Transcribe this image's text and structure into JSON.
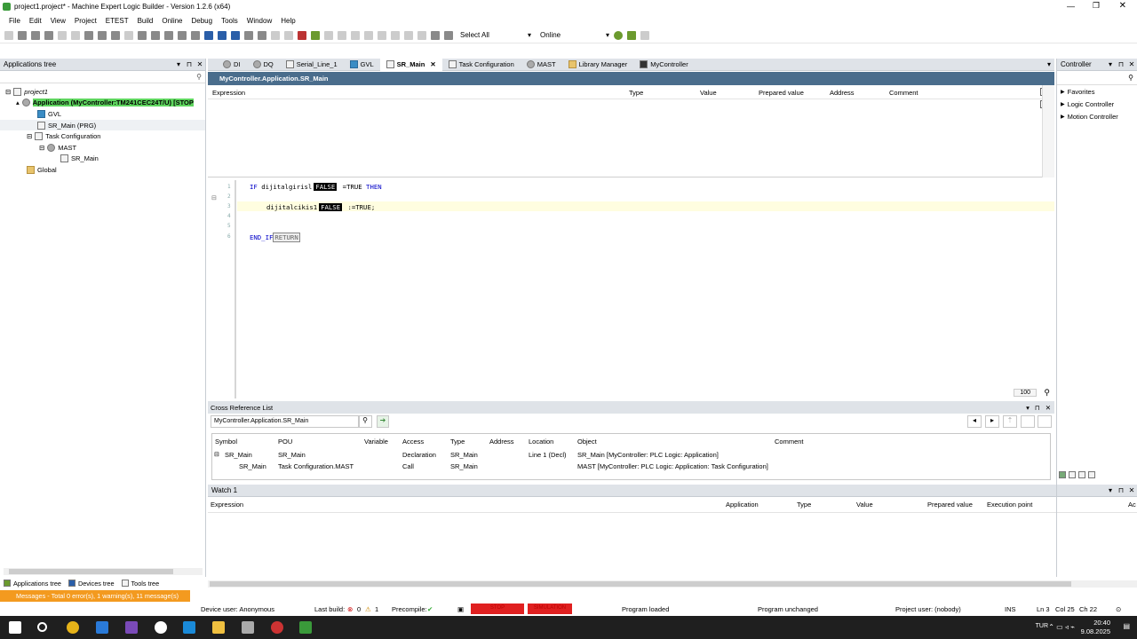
{
  "window": {
    "title": "project1.project* - Machine Expert Logic Builder - Version 1.2.6 (x64)"
  },
  "menu": [
    "File",
    "Edit",
    "View",
    "Project",
    "ETEST",
    "Build",
    "Online",
    "Debug",
    "Tools",
    "Window",
    "Help"
  ],
  "toolbar": {
    "select_all": "Select All",
    "online": "Online"
  },
  "apps_tree": {
    "title": "Applications tree",
    "items": [
      {
        "label": "project1",
        "icon": "project-icon"
      },
      {
        "label": "Application (MyController:TM241CEC24T/U) [STOP",
        "icon": "application-icon"
      },
      {
        "label": "GVL",
        "icon": "gvl-icon"
      },
      {
        "label": "SR_Main (PRG)",
        "icon": "program-icon"
      },
      {
        "label": "Task Configuration",
        "icon": "task-config-icon"
      },
      {
        "label": "MAST",
        "icon": "task-icon"
      },
      {
        "label": "SR_Main",
        "icon": "program-icon"
      },
      {
        "label": "Global",
        "icon": "folder-icon"
      }
    ]
  },
  "tabs": [
    {
      "label": "DI"
    },
    {
      "label": "DQ"
    },
    {
      "label": "Serial_Line_1"
    },
    {
      "label": "GVL"
    },
    {
      "label": "SR_Main"
    },
    {
      "label": "Task Configuration"
    },
    {
      "label": "MAST"
    },
    {
      "label": "Library Manager"
    },
    {
      "label": "MyController"
    }
  ],
  "editor": {
    "path": "MyController.Application.SR_Main",
    "columns": [
      "Expression",
      "Type",
      "Value",
      "Prepared value",
      "Address",
      "Comment"
    ],
    "lines": [
      {
        "n": "1",
        "pre": "IF ",
        "var": "dijitalgirisl",
        "val": "FALSE",
        "post": " =TRUE ",
        "kw": "THEN"
      },
      {
        "n": "2"
      },
      {
        "n": "3",
        "indent": "dijitalcikis1",
        "val": "FALSE",
        "post": " :=TRUE;"
      },
      {
        "n": "4"
      },
      {
        "n": "5"
      },
      {
        "n": "6",
        "kw2": "END_IF",
        "ret": "RETURN"
      }
    ],
    "zoom": "100"
  },
  "crossref": {
    "title": "Cross Reference List",
    "search": "MyController.Application.SR_Main",
    "columns": [
      "Symbol",
      "POU",
      "Variable",
      "Access",
      "Type",
      "Address",
      "Location",
      "Object",
      "Comment"
    ],
    "rows": [
      {
        "symbol": "SR_Main",
        "pou": "SR_Main",
        "access": "Declaration",
        "type": "SR_Main",
        "location": "Line 1 (Decl)",
        "object": "SR_Main [MyController: PLC Logic: Application]"
      },
      {
        "symbol": "SR_Main",
        "pou": "Task Configuration.MAST",
        "access": "Call",
        "type": "SR_Main",
        "location": "",
        "object": "MAST [MyController: PLC Logic: Application: Task Configuration]"
      }
    ]
  },
  "watch1": {
    "title": "Watch 1",
    "columns": [
      "Expression",
      "Application",
      "Type",
      "Value",
      "Prepared value",
      "Execution point",
      "Ac"
    ]
  },
  "controller": {
    "title": "Controller",
    "items": [
      "Favorites",
      "Logic Controller",
      "Motion Controller"
    ]
  },
  "bottom_tabs": [
    "Applications tree",
    "Devices tree",
    "Tools tree"
  ],
  "messages": "Messages - Total 0 error(s), 1 warning(s), 11 message(s)",
  "status": {
    "device_user": "Device user: Anonymous",
    "last_build": "Last build:",
    "errors": "0",
    "warnings": "1",
    "precompile": "Precompile:",
    "stop": "STOP",
    "simulation": "SIMULATION",
    "program_loaded": "Program loaded",
    "program_unchanged": "Program unchanged",
    "project_user": "Project user: (nobody)",
    "ins": "INS",
    "ln": "Ln 3",
    "col": "Col 25",
    "ch": "Ch 22"
  },
  "clock": {
    "time": "20:40",
    "date": "9.08.2025",
    "lang": "TUR"
  }
}
